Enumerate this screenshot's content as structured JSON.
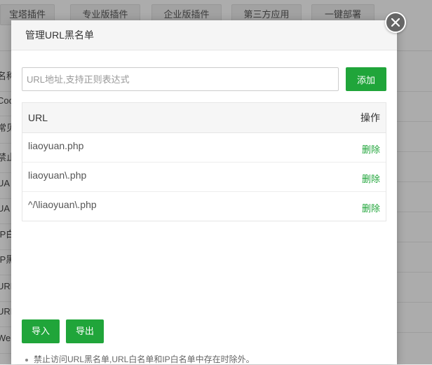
{
  "background": {
    "tabs": [
      "宝塔插件",
      "专业版插件",
      "企业版插件",
      "第三方应用",
      "一键部署"
    ],
    "side_rows": [
      "名称",
      "Coo",
      "常见",
      "禁止",
      "UA",
      "UA",
      "IP白",
      "IP黑",
      "URL",
      "URL",
      "We"
    ]
  },
  "modal": {
    "title": "管理URL黑名单",
    "input": {
      "placeholder": "URL地址,支持正则表达式",
      "value": ""
    },
    "add_label": "添加",
    "table": {
      "headers": {
        "url": "URL",
        "op": "操作"
      },
      "rows": [
        {
          "url": "liaoyuan.php",
          "action": "删除"
        },
        {
          "url": "liaoyuan\\.php",
          "action": "删除"
        },
        {
          "url": "^/\\liaoyuan\\.php",
          "action": "删除"
        }
      ]
    },
    "import_label": "导入",
    "export_label": "导出",
    "note": "禁止访问URL黑名单,URL白名单和IP白名单中存在时除外。"
  },
  "colors": {
    "accent": "#20a53a",
    "close_bg": "#666666"
  },
  "icons": {
    "close": "close-icon"
  }
}
